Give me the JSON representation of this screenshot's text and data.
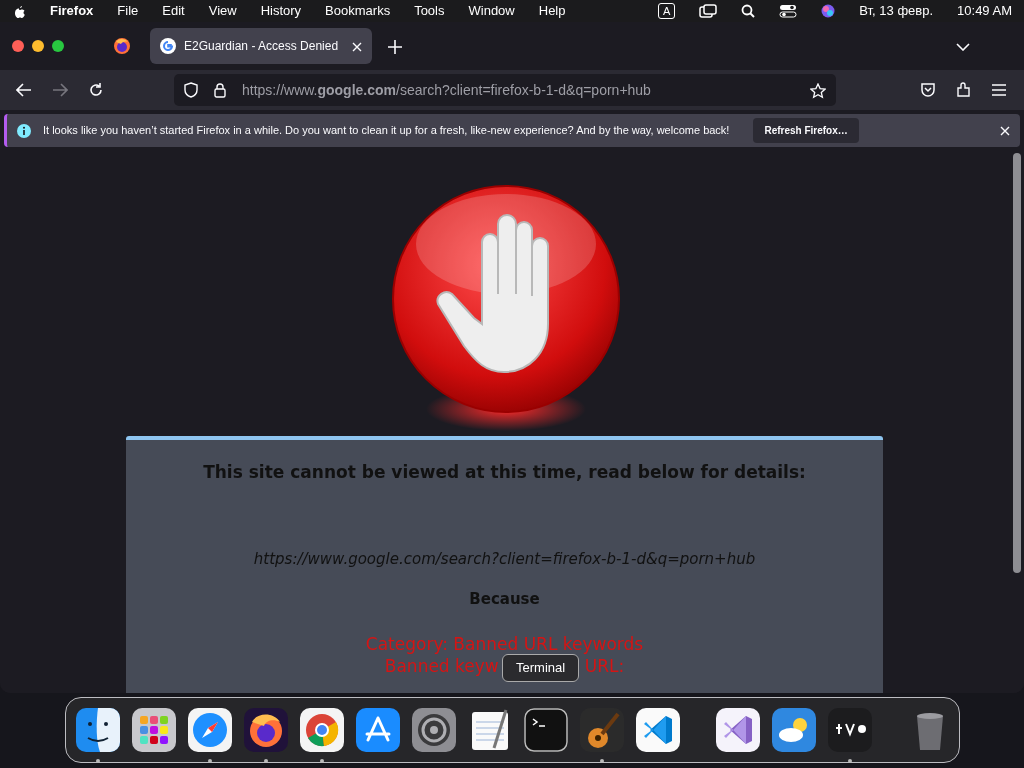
{
  "menubar": {
    "app": "Firefox",
    "menus": [
      "File",
      "Edit",
      "View",
      "History",
      "Bookmarks",
      "Tools",
      "Window",
      "Help"
    ],
    "input_source": "A",
    "date": "Вт, 13 февр.",
    "time": "10:49 AM"
  },
  "tabs": [
    {
      "kind": "pinned",
      "selected": false
    },
    {
      "kind": "page",
      "title": "E2Guardian - Access Denied",
      "selected": true
    }
  ],
  "address": {
    "url": "https://www.**google.com**/search?client=firefox-b-1-d&q=porn+hub"
  },
  "notification": {
    "message": "It looks like you haven’t started Firefox in a while. Do you want to clean it up for a fresh, like-new experience? And by the way, welcome back!",
    "button": "Refresh Firefox…"
  },
  "page": {
    "heading": "This site cannot be viewed at this time, read below for details:",
    "url": "https://www.google.com/search?client=firefox-b-1-d&q=porn+hub",
    "because": "Because",
    "category": "Category: Banned URL keywords",
    "keyword_left": "Banned keyw",
    "keyword_right": "URL:"
  },
  "tooltip": "Terminal",
  "dock": [
    {
      "kind": "finder",
      "running": true
    },
    {
      "kind": "launchpad",
      "running": false
    },
    {
      "kind": "safari",
      "running": true
    },
    {
      "kind": "firefox",
      "running": true
    },
    {
      "kind": "chrome",
      "running": true
    },
    {
      "kind": "appstore",
      "running": false
    },
    {
      "kind": "settings",
      "running": false
    },
    {
      "kind": "textedit",
      "running": false
    },
    {
      "kind": "terminal",
      "running": false
    },
    {
      "kind": "garageband",
      "running": true
    },
    {
      "kind": "vscode",
      "running": false
    },
    {
      "kind": "separator"
    },
    {
      "kind": "visualstudio",
      "running": false
    },
    {
      "kind": "weather",
      "running": false
    },
    {
      "kind": "appletv",
      "running": true
    },
    {
      "kind": "separator"
    },
    {
      "kind": "trash",
      "running": false
    }
  ]
}
